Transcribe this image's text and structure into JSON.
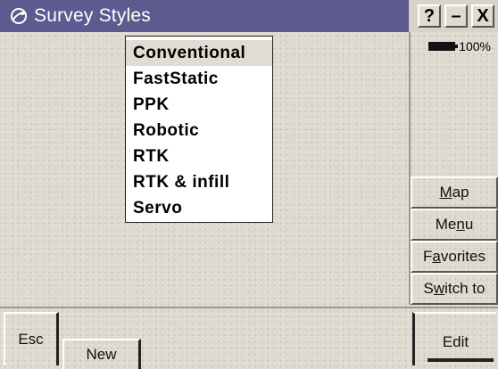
{
  "window": {
    "title": "Survey Styles",
    "help_label": "?",
    "minimize_label": "–",
    "close_label": "X"
  },
  "status": {
    "battery_percent": "100%"
  },
  "dropdown": {
    "items": [
      "Conventional",
      "FastStatic",
      "PPK",
      "Robotic",
      "RTK",
      "RTK & infill",
      "Servo"
    ],
    "selected_index": 0
  },
  "side_buttons": {
    "map": {
      "underline": "M",
      "rest": "ap"
    },
    "menu": {
      "pre": "Me",
      "underline": "n",
      "rest": "u"
    },
    "favorites": {
      "pre": "F",
      "underline": "a",
      "rest": "vorites"
    },
    "switch_to": {
      "pre": "S",
      "underline": "w",
      "rest": "itch to"
    }
  },
  "bottom_buttons": {
    "esc": "Esc",
    "new": "New",
    "edit": "Edit"
  },
  "colors": {
    "titlebar": "#5c5a8e",
    "background": "#ddd9cf"
  }
}
